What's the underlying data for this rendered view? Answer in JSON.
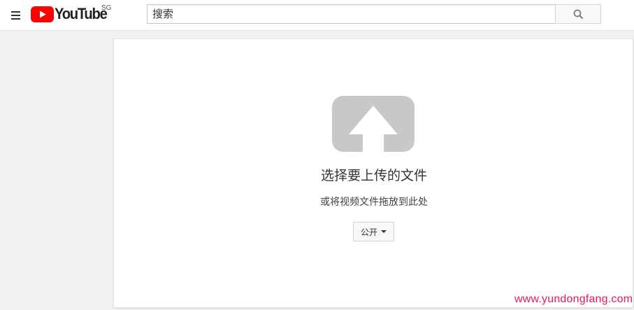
{
  "masthead": {
    "menu_icon": "hamburger-menu-icon",
    "logo_text": "YouTube",
    "logo_region": "SG",
    "search": {
      "placeholder": "搜索",
      "value": "",
      "icon": "search-icon"
    }
  },
  "upload": {
    "icon": "upload-arrow-icon",
    "title": "选择要上传的文件",
    "subtitle": "或将视频文件拖放到此处",
    "privacy_selected": "公开"
  },
  "watermark": "www.yundongfang.com",
  "colors": {
    "brand_red": "#ff0000",
    "upload_icon_gray": "#c8c8c8",
    "watermark_pink": "#e8185a",
    "page_background": "#f1f1f1"
  }
}
